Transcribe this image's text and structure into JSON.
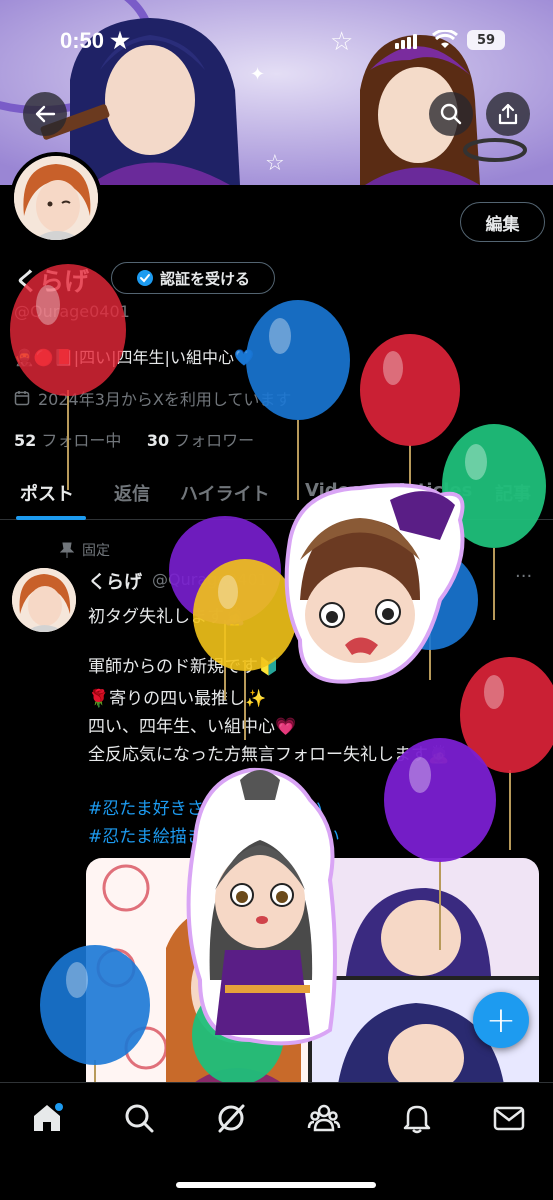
{
  "status_bar": {
    "time": "0:50",
    "star": "★",
    "battery": "59"
  },
  "header": {
    "back_icon": "arrow-left-icon",
    "search_icon": "search-icon",
    "share_icon": "share-icon"
  },
  "profile": {
    "edit_label": "編集",
    "display_name": "くらげ",
    "verify_label": "認証を受ける",
    "handle": "@Qurage0401",
    "bio": "🥷🔴📕|四い|四年生|い組中心💙",
    "joined": "2024年3月からXを利用しています",
    "following_count": "52",
    "following_label": "フォロー中",
    "followers_count": "30",
    "followers_label": "フォロワー"
  },
  "tabs": [
    {
      "label": "ポスト"
    },
    {
      "label": "返信"
    },
    {
      "label": "ハイライト"
    },
    {
      "label": "Videos"
    },
    {
      "label": "Articles"
    },
    {
      "label": "記事"
    }
  ],
  "post": {
    "pinned_label": "固定",
    "name": "くらげ",
    "handle": "@Qurage0401",
    "more": "···",
    "lines": [
      "初タグ失礼します🙇‍♀️",
      "",
      "軍師からのド新規です🔰",
      "🌹寄りの四い最推し✨",
      "四い、四年生、い組中心💗",
      "全反応気になった方無言フォロー失礼します🙇"
    ],
    "tags": [
      "#忍たま好きさんと繋がりたい",
      "#忍たま絵描きさんと繋がりたい"
    ]
  },
  "fab_label": "+",
  "nav": [
    "home-icon",
    "search-icon",
    "grok-icon",
    "communities-icon",
    "notifications-icon",
    "messages-icon"
  ],
  "colors": {
    "accent": "#1d9bf0",
    "background": "#000000",
    "muted": "#71767b",
    "text": "#e7e9ea",
    "border": "#2f3336"
  }
}
